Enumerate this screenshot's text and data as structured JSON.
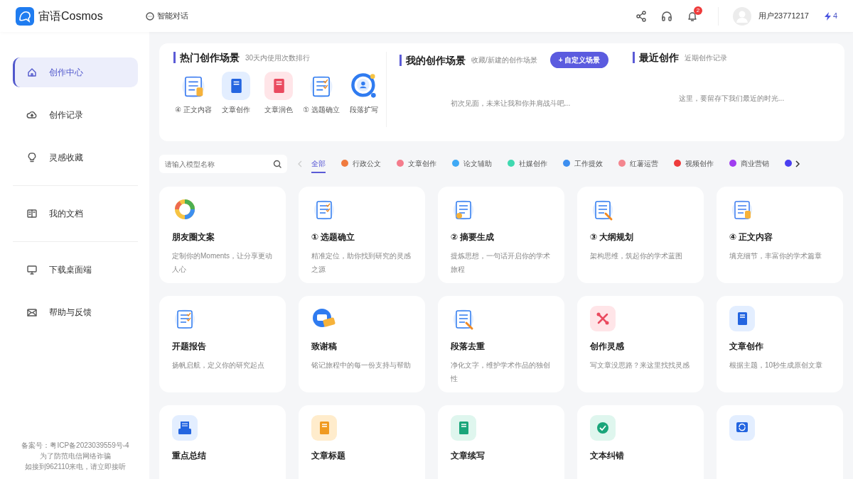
{
  "header": {
    "brand": "宙语Cosmos",
    "nav_link": "智能对话",
    "notification_count": "2",
    "user_name": "用户23771217",
    "credits": "4"
  },
  "sidebar": {
    "items": [
      {
        "label": "创作中心",
        "selected": true
      },
      {
        "label": "创作记录",
        "selected": false
      },
      {
        "label": "灵感收藏",
        "selected": false
      },
      {
        "label": "我的文档",
        "selected": false
      },
      {
        "label": "下载桌面端",
        "selected": false
      },
      {
        "label": "帮助与反馈",
        "selected": false
      }
    ],
    "footer": [
      "备案号：粤ICP备2023039559号-4",
      "为了防范电信网络诈骗",
      "如接到962110来电，请立即接听"
    ]
  },
  "hot_scenes": {
    "title": "热门创作场景",
    "subtitle": "30天内使用次数排行",
    "items": [
      "④ 正文内容",
      "文章创作",
      "文章润色",
      "① 选题确立",
      "段落扩写"
    ]
  },
  "my_scenes": {
    "title": "我的创作场景",
    "subtitle": "收藏/新建的创作场景",
    "button": "+ 自定义场景",
    "empty_text": "初次见面，未来让我和你并肩战斗吧..."
  },
  "recent": {
    "title": "最近创作",
    "subtitle": "近期创作记录",
    "empty_text": "这里，要留存下我们最近的时光..."
  },
  "search": {
    "placeholder": "请输入模型名称"
  },
  "categories": [
    {
      "label": "全部",
      "selected": true
    },
    {
      "label": "行政公文",
      "color": "#f07b3f",
      "selected": false
    },
    {
      "label": "文章创作",
      "color": "#f47c8c",
      "selected": false
    },
    {
      "label": "论文辅助",
      "color": "#3fa9f5",
      "selected": false
    },
    {
      "label": "社媒创作",
      "color": "#3fd9b0",
      "selected": false
    },
    {
      "label": "工作提效",
      "color": "#3d8ff0",
      "selected": false
    },
    {
      "label": "红薯运营",
      "color": "#f4868f",
      "selected": false
    },
    {
      "label": "视频创作",
      "color": "#ee3c3c",
      "selected": false
    },
    {
      "label": "商业营销",
      "color": "#a03ef0",
      "selected": false
    },
    {
      "color": "#4a3ff0",
      "selected": false
    }
  ],
  "cards": [
    {
      "title": "朋友圈文案",
      "desc": "定制你的Moments，让分享更动人心"
    },
    {
      "title": "① 选题确立",
      "desc": "精准定位，助你找到研究的灵感之源"
    },
    {
      "title": "② 摘要生成",
      "desc": "提炼思想，一句话开启你的学术旅程"
    },
    {
      "title": "③ 大纲规划",
      "desc": "架构思维，筑起你的学术蓝图"
    },
    {
      "title": "④ 正文内容",
      "desc": "填充细节，丰富你的学术篇章"
    },
    {
      "title": "开题报告",
      "desc": "扬帆启航，定义你的研究起点"
    },
    {
      "title": "致谢稿",
      "desc": "铭记旅程中的每一份支持与帮助"
    },
    {
      "title": "段落去重",
      "desc": "净化文字，维护学术作品的独创性"
    },
    {
      "title": "创作灵感",
      "desc": "写文章没思路？来这里找找灵感"
    },
    {
      "title": "文章创作",
      "desc": "根据主题，10秒生成原创文章"
    },
    {
      "title": "重点总结"
    },
    {
      "title": "文章标题"
    },
    {
      "title": "文章续写"
    },
    {
      "title": "文本纠错"
    }
  ]
}
